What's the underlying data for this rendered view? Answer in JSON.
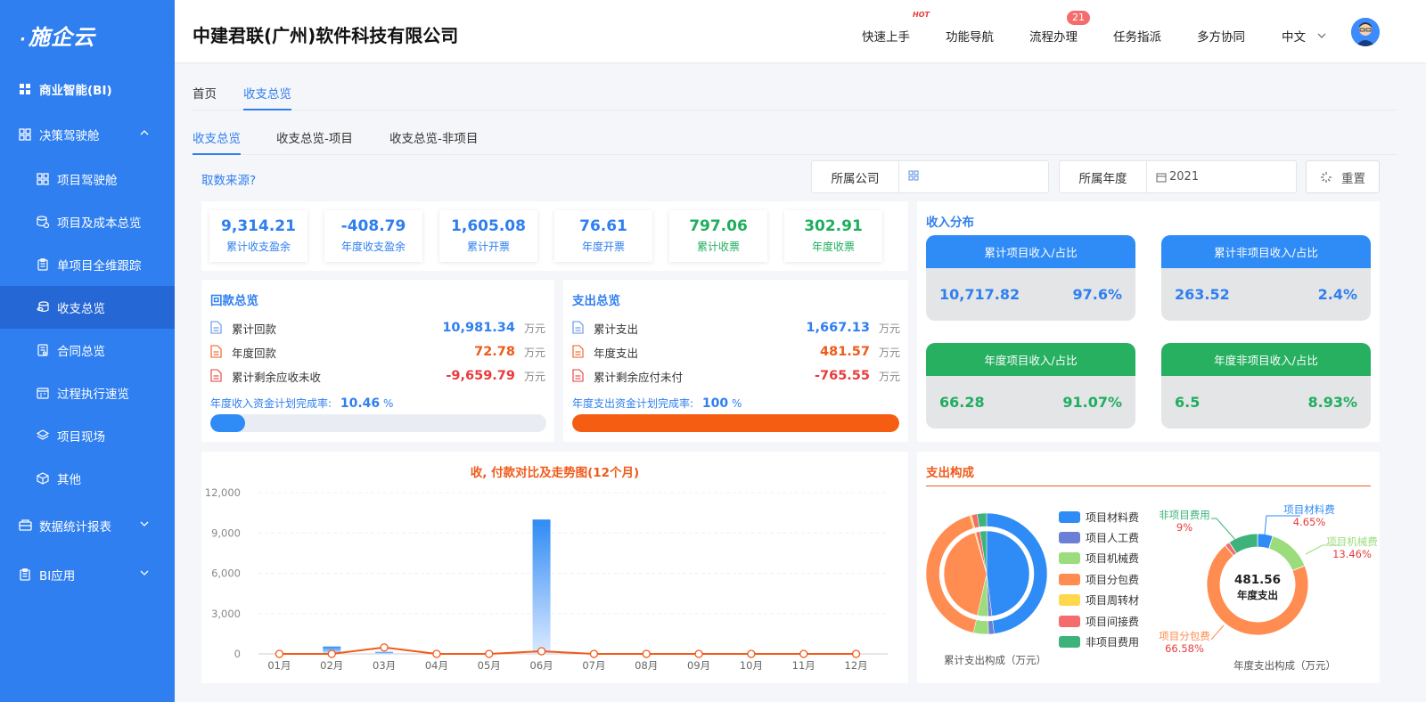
{
  "sidebar": {
    "logo": "施企云",
    "items": [
      {
        "label": "商业智能(BI)"
      },
      {
        "label": "决策驾驶舱"
      },
      {
        "label": "项目驾驶舱"
      },
      {
        "label": "项目及成本总览"
      },
      {
        "label": "单项目全维跟踪"
      },
      {
        "label": "收支总览"
      },
      {
        "label": "合同总览"
      },
      {
        "label": "过程执行速览"
      },
      {
        "label": "项目现场"
      },
      {
        "label": "其他"
      },
      {
        "label": "数据统计报表"
      },
      {
        "label": "BI应用"
      }
    ]
  },
  "header": {
    "company": "中建君联(广州)软件科技有限公司",
    "nav": [
      "快速上手",
      "功能导航",
      "流程办理",
      "任务指派",
      "多方协同"
    ],
    "hot_tag": "HOT",
    "badge": "21",
    "language": "中文"
  },
  "tabs1": [
    "首页",
    "收支总览"
  ],
  "tabs2": [
    "收支总览",
    "收支总览-项目",
    "收支总览-非项目"
  ],
  "filters": {
    "source_link": "取数来源?",
    "company_label": "所属公司",
    "year_label": "所属年度",
    "year_value": "2021",
    "reset": "重置"
  },
  "kpis": [
    {
      "value": "9,314.21",
      "label": "累计收支盈余",
      "color": "#2f7ff0"
    },
    {
      "value": "-408.79",
      "label": "年度收支盈余",
      "color": "#2f7ff0"
    },
    {
      "value": "1,605.08",
      "label": "累计开票",
      "color": "#2f7ff0"
    },
    {
      "value": "76.61",
      "label": "年度开票",
      "color": "#2f7ff0"
    },
    {
      "value": "797.06",
      "label": "累计收票",
      "color": "#1fae5e"
    },
    {
      "value": "302.91",
      "label": "年度收票",
      "color": "#1fae5e"
    }
  ],
  "receipts": {
    "title": "回款总览",
    "rows": [
      {
        "label": "累计回款",
        "value": "10,981.34",
        "unit": "万元"
      },
      {
        "label": "年度回款",
        "value": "72.78",
        "unit": "万元"
      },
      {
        "label": "累计剩余应收未收",
        "value": "-9,659.79",
        "unit": "万元"
      }
    ],
    "rate_label": "年度收入资金计划完成率:",
    "rate_value": "10.46",
    "rate_unit": "%",
    "rate_fraction": 0.1046
  },
  "expenses": {
    "title": "支出总览",
    "rows": [
      {
        "label": "累计支出",
        "value": "1,667.13",
        "unit": "万元"
      },
      {
        "label": "年度支出",
        "value": "481.57",
        "unit": "万元"
      },
      {
        "label": "累计剩余应付未付",
        "value": "-765.55",
        "unit": "万元"
      }
    ],
    "rate_label": "年度支出资金计划完成率:",
    "rate_value": "100",
    "rate_unit": "%",
    "rate_fraction": 1.0
  },
  "income": {
    "title": "收入分布",
    "cards": [
      {
        "header": "累计项目收入/占比",
        "value": "10,717.82",
        "pct": "97.6%",
        "color": "#2f8bf5"
      },
      {
        "header": "累计非项目收入/占比",
        "value": "263.52",
        "pct": "2.4%",
        "color": "#2f8bf5"
      },
      {
        "header": "年度项目收入/占比",
        "value": "66.28",
        "pct": "91.07%",
        "color": "#27b060"
      },
      {
        "header": "年度非项目收入/占比",
        "value": "6.5",
        "pct": "8.93%",
        "color": "#27b060"
      }
    ]
  },
  "trend_chart": {
    "title": "收, 付款对比及走势图(12个月)"
  },
  "chart_data": [
    {
      "type": "bar",
      "title": "收, 付款对比及走势图(12个月)",
      "categories": [
        "01月",
        "02月",
        "03月",
        "04月",
        "05月",
        "06月",
        "07月",
        "08月",
        "09月",
        "10月",
        "11月",
        "12月"
      ],
      "ylim": [
        0,
        12000
      ],
      "yticks": [
        0,
        3000,
        6000,
        9000,
        12000
      ],
      "ytick_labels": [
        "0",
        "3,000",
        "6,000",
        "9,000",
        "12,000"
      ],
      "series": [
        {
          "type": "bar",
          "color": "#2f8bf5",
          "values": [
            0,
            550,
            150,
            0,
            0,
            10000,
            0,
            0,
            0,
            0,
            0,
            0
          ]
        },
        {
          "type": "line",
          "color": "#f05a1a",
          "values": [
            0,
            0,
            481.57,
            0,
            0,
            200,
            0,
            0,
            0,
            0,
            0,
            0
          ]
        }
      ]
    },
    {
      "type": "pie",
      "xlabel": "累计支出构成（万元）",
      "labels": [
        "项目材料费",
        "项目人工费",
        "项目机械费",
        "项目分包费",
        "项目周转材",
        "项目间接费",
        "非项目费用"
      ],
      "colors": [
        "#2f8bf5",
        "#6b7fd6",
        "#9bdc7c",
        "#ff8c50",
        "#ffd84d",
        "#f56c6c",
        "#3db37b"
      ],
      "values": [
        48,
        1.5,
        4,
        42,
        0.5,
        1.5,
        2.5
      ]
    },
    {
      "type": "pie",
      "center_value": "481.56",
      "center_label": "年度支出",
      "xlabel": "年度支出构成（万元）",
      "labels": [
        "项目材料费",
        "项目机械费",
        "项目分包费",
        "项目间接费",
        "非项目费用"
      ],
      "colors": [
        "#2f8bf5",
        "#9bdc7c",
        "#ff8c50",
        "#f56c6c",
        "#3db37b"
      ],
      "values": [
        4.65,
        13.46,
        66.58,
        1.5,
        9
      ],
      "pct_labels": [
        "4.65%",
        "13.46%",
        "66.58%",
        "",
        "9%"
      ]
    }
  ],
  "expense_comp": {
    "title": "支出构成",
    "legend": [
      "项目材料费",
      "项目人工费",
      "项目机械费",
      "项目分包费",
      "项目周转材",
      "项目间接费",
      "非项目费用"
    ],
    "legend_colors": [
      "#2f8bf5",
      "#6b7fd6",
      "#9bdc7c",
      "#ff8c50",
      "#ffd84d",
      "#f56c6c",
      "#3db37b"
    ],
    "left_caption": "累计支出构成（万元）",
    "right_caption": "年度支出构成（万元）",
    "center_value": "481.56",
    "center_label": "年度支出",
    "callouts": [
      {
        "name": "项目材料费",
        "pct": "4.65%"
      },
      {
        "name": "项目机械费",
        "pct": "13.46%"
      },
      {
        "name": "项目分包费",
        "pct": "66.58%"
      },
      {
        "name": "非项目费用",
        "pct": "9%"
      }
    ]
  }
}
